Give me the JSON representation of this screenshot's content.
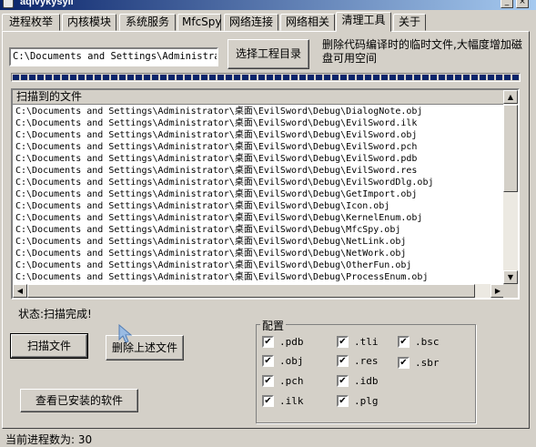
{
  "window": {
    "title": "aqlvykysyli"
  },
  "tabs": [
    {
      "label": "进程枚举"
    },
    {
      "label": "内核模块"
    },
    {
      "label": "系统服务"
    },
    {
      "label": "MfcSpy"
    },
    {
      "label": "网络连接"
    },
    {
      "label": "网络相关"
    },
    {
      "label": "清理工具"
    },
    {
      "label": "关于"
    }
  ],
  "active_tab": "清理工具",
  "path_field": {
    "value": "C:\\Documents and Settings\\Administrat"
  },
  "select_dir_button": "选择工程目录",
  "description": "删除代码编译时的临时文件,大幅度增加磁盘可用空间",
  "progress": {
    "percent": 100
  },
  "file_list": {
    "header": "扫描到的文件",
    "rows": [
      "C:\\Documents and Settings\\Administrator\\桌面\\EvilSword\\Debug\\DialogNote.obj",
      "C:\\Documents and Settings\\Administrator\\桌面\\EvilSword\\Debug\\EvilSword.ilk",
      "C:\\Documents and Settings\\Administrator\\桌面\\EvilSword\\Debug\\EvilSword.obj",
      "C:\\Documents and Settings\\Administrator\\桌面\\EvilSword\\Debug\\EvilSword.pch",
      "C:\\Documents and Settings\\Administrator\\桌面\\EvilSword\\Debug\\EvilSword.pdb",
      "C:\\Documents and Settings\\Administrator\\桌面\\EvilSword\\Debug\\EvilSword.res",
      "C:\\Documents and Settings\\Administrator\\桌面\\EvilSword\\Debug\\EvilSwordDlg.obj",
      "C:\\Documents and Settings\\Administrator\\桌面\\EvilSword\\Debug\\GetImport.obj",
      "C:\\Documents and Settings\\Administrator\\桌面\\EvilSword\\Debug\\Icon.obj",
      "C:\\Documents and Settings\\Administrator\\桌面\\EvilSword\\Debug\\KernelEnum.obj",
      "C:\\Documents and Settings\\Administrator\\桌面\\EvilSword\\Debug\\MfcSpy.obj",
      "C:\\Documents and Settings\\Administrator\\桌面\\EvilSword\\Debug\\NetLink.obj",
      "C:\\Documents and Settings\\Administrator\\桌面\\EvilSword\\Debug\\NetWork.obj",
      "C:\\Documents and Settings\\Administrator\\桌面\\EvilSword\\Debug\\OtherFun.obj",
      "C:\\Documents and Settings\\Administrator\\桌面\\EvilSword\\Debug\\ProcessEnum.obj"
    ]
  },
  "status": "状态:扫描完成!",
  "buttons": {
    "scan": "扫描文件",
    "delete": "删除上述文件",
    "installed": "查看已安装的软件"
  },
  "config": {
    "legend": "配置",
    "options": [
      {
        "label": ".pdb",
        "checked": true
      },
      {
        "label": ".obj",
        "checked": true
      },
      {
        "label": ".pch",
        "checked": true
      },
      {
        "label": ".ilk",
        "checked": true
      },
      {
        "label": ".tli",
        "checked": true
      },
      {
        "label": ".res",
        "checked": true
      },
      {
        "label": ".idb",
        "checked": true
      },
      {
        "label": ".plg",
        "checked": true
      },
      {
        "label": ".bsc",
        "checked": true
      },
      {
        "label": ".sbr",
        "checked": true
      }
    ],
    "check_mark": "✔"
  },
  "bottom_status": "当前进程数为: 30",
  "icons": {
    "app": "app-icon",
    "minimize": "minimize-icon",
    "close": "close-icon",
    "scroll_up": "up-arrow-icon",
    "scroll_down": "down-arrow-icon",
    "scroll_left": "left-arrow-icon",
    "scroll_right": "right-arrow-icon",
    "cursor": "mouse-cursor-icon"
  }
}
